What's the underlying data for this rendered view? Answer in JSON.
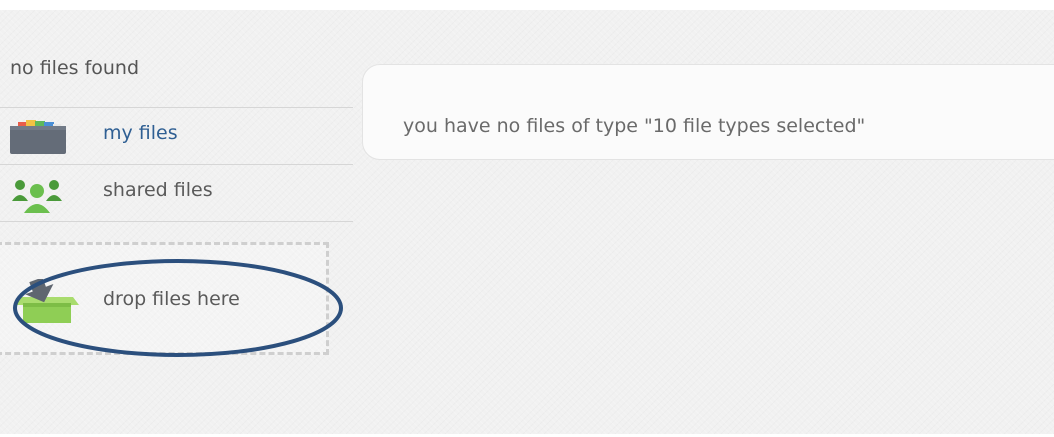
{
  "sidebar": {
    "status": "no files found",
    "items": [
      {
        "label": "my files",
        "icon": "folder-icon",
        "active": true
      },
      {
        "label": "shared files",
        "icon": "people-icon",
        "active": false
      }
    ],
    "dropzone": {
      "label": "drop files here",
      "icon": "drop-box-icon"
    }
  },
  "main": {
    "empty_message": "you have no files of type \"10 file types selected\""
  },
  "colors": {
    "active_link": "#2f5f93",
    "text": "#5a5a5a",
    "annotation_ring": "#2b4f7d",
    "people_icon": "#6bbf4e",
    "drop_box": "#8fce55"
  }
}
